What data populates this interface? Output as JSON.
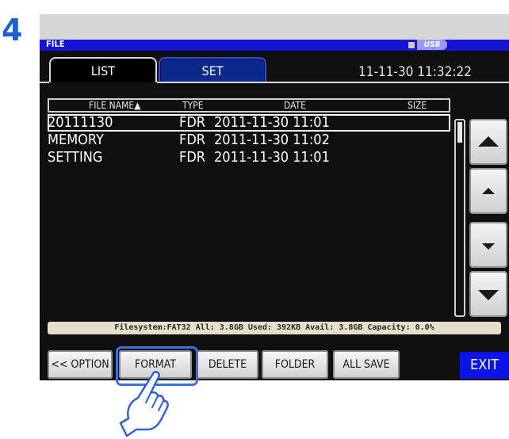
{
  "step": "4",
  "window": {
    "title": "FILE",
    "usb_label": "USB"
  },
  "tabs": [
    {
      "label": "LIST",
      "active": true
    },
    {
      "label": "SET",
      "active": false
    }
  ],
  "datetime": "11-11-30 11:32:22",
  "table": {
    "columns": {
      "name": "FILE NAME▲",
      "type": "TYPE",
      "date": "DATE",
      "size": "SIZE"
    },
    "rows": [
      {
        "name": "20111130",
        "type": "FDR",
        "date": "2011-11-30 11:01",
        "selected": true
      },
      {
        "name": "MEMORY",
        "type": "FDR",
        "date": "2011-11-30 11:02",
        "selected": false
      },
      {
        "name": "SETTING",
        "type": "FDR",
        "date": "2011-11-30 11:01",
        "selected": false
      }
    ]
  },
  "status": "Filesystem:FAT32 All: 3.8GB Used: 392KB Avail: 3.8GB Capacity: 0.0%",
  "buttons": {
    "option": "<< OPTION",
    "format": "FORMAT",
    "delete": "DELETE",
    "folder": "FOLDER",
    "all_save": "ALL SAVE",
    "exit": "EXIT"
  },
  "scroll_buttons": [
    "page-up-icon",
    "up-icon",
    "down-icon",
    "page-down-icon"
  ],
  "colors": {
    "accent_blue": "#1414d6",
    "exit_blue": "#0a14e6",
    "step_number": "#1e5fd0",
    "highlight": "#3f6fe0"
  }
}
